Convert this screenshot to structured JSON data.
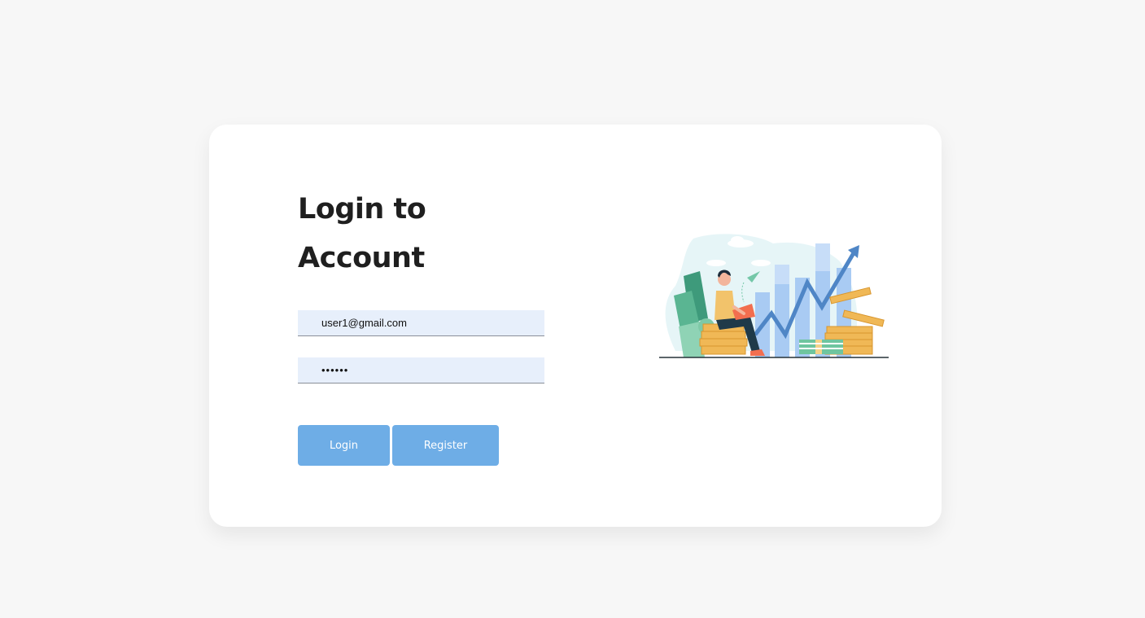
{
  "login": {
    "title_line1": "Login to",
    "title_line2": "Account",
    "email_value": "user1@gmail.com",
    "password_value": "••••••",
    "login_label": "Login",
    "register_label": "Register"
  },
  "colors": {
    "page_bg": "#f7f7f7",
    "card_bg": "#ffffff",
    "field_bg": "#e7effb",
    "button_bg": "#6eade6",
    "title_text": "#1f1f1f"
  },
  "illustration": {
    "icons": [
      "person-with-laptop-icon",
      "money-bills-icon",
      "coin-stack-icon",
      "bar-chart-icon",
      "growth-arrow-icon",
      "paper-plane-icon",
      "cloud-icon"
    ]
  }
}
